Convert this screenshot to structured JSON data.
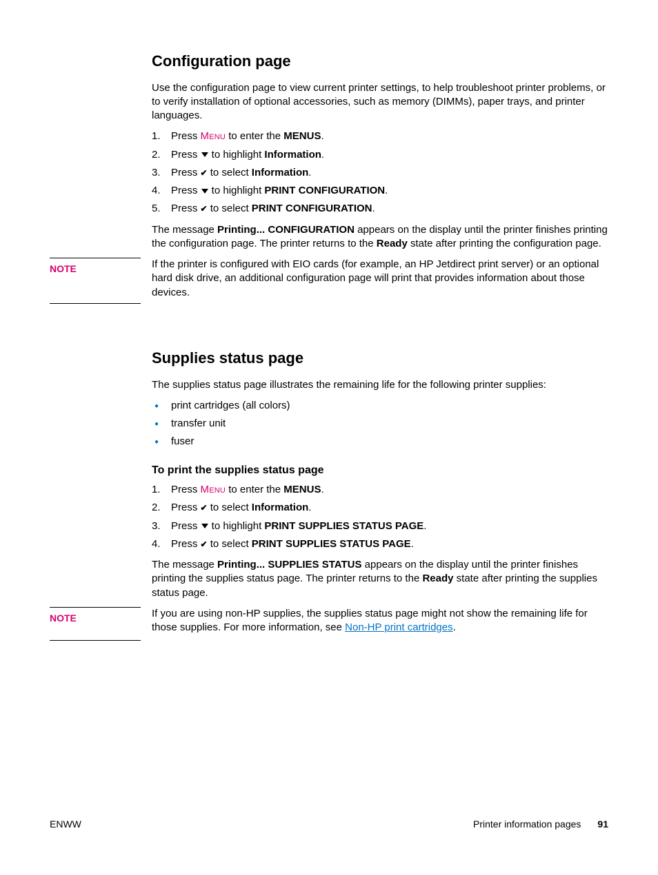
{
  "section1": {
    "heading": "Configuration page",
    "intro": "Use the configuration page to view current printer settings, to help troubleshoot printer problems, or to verify installation of optional accessories, such as memory (DIMMs), paper trays, and printer languages.",
    "steps": {
      "s1_a": "Press ",
      "s1_menu": "Menu",
      "s1_b": " to enter the ",
      "s1_bold": "MENUS",
      "s1_c": ".",
      "s2_a": "Press ",
      "s2_b": " to highlight ",
      "s2_bold": "Information",
      "s2_c": ".",
      "s3_a": "Press ",
      "s3_b": " to select ",
      "s3_bold": "Information",
      "s3_c": ".",
      "s4_a": "Press ",
      "s4_b": " to highlight ",
      "s4_bold": "PRINT CONFIGURATION",
      "s4_c": ".",
      "s5_a": "Press ",
      "s5_b": " to select ",
      "s5_bold": "PRINT CONFIGURATION",
      "s5_c": "."
    },
    "after_a": "The message ",
    "after_bold": "Printing... CONFIGURATION",
    "after_b": " appears on the display until the printer finishes printing the configuration page. The printer returns to the ",
    "after_bold2": "Ready",
    "after_c": " state after printing the configuration page.",
    "note_label": "NOTE",
    "note_body": "If the printer is configured with EIO cards (for example, an HP Jetdirect print server) or an optional hard disk drive, an additional configuration page will print that provides information about those devices."
  },
  "section2": {
    "heading": "Supplies status page",
    "intro": "The supplies status page illustrates the remaining life for the following printer supplies:",
    "bullets": {
      "b1": "print cartridges (all colors)",
      "b2": "transfer unit",
      "b3": "fuser"
    },
    "sub_heading": "To print the supplies status page",
    "steps": {
      "s1_a": "Press ",
      "s1_menu": "Menu",
      "s1_b": " to enter the ",
      "s1_bold": "MENUS",
      "s1_c": ".",
      "s2_a": "Press ",
      "s2_b": " to select ",
      "s2_bold": "Information",
      "s2_c": ".",
      "s3_a": "Press ",
      "s3_b": " to highlight ",
      "s3_bold": "PRINT SUPPLIES STATUS PAGE",
      "s3_c": ".",
      "s4_a": "Press ",
      "s4_b": " to select ",
      "s4_bold": "PRINT SUPPLIES STATUS PAGE",
      "s4_c": "."
    },
    "after_a": "The message ",
    "after_bold": "Printing... SUPPLIES STATUS",
    "after_b": " appears on the display until the printer finishes printing the supplies status page. The printer returns to the ",
    "after_bold2": "Ready",
    "after_c": " state after printing the supplies status page.",
    "note_label": "NOTE",
    "note_body_a": "If you are using non-HP supplies, the supplies status page might not show the remaining life for those supplies. For more information, see ",
    "note_link": "Non-HP print cartridges",
    "note_body_b": "."
  },
  "footer": {
    "left": "ENWW",
    "section": "Printer information pages",
    "page": "91"
  },
  "icons": {
    "check": "✔"
  }
}
